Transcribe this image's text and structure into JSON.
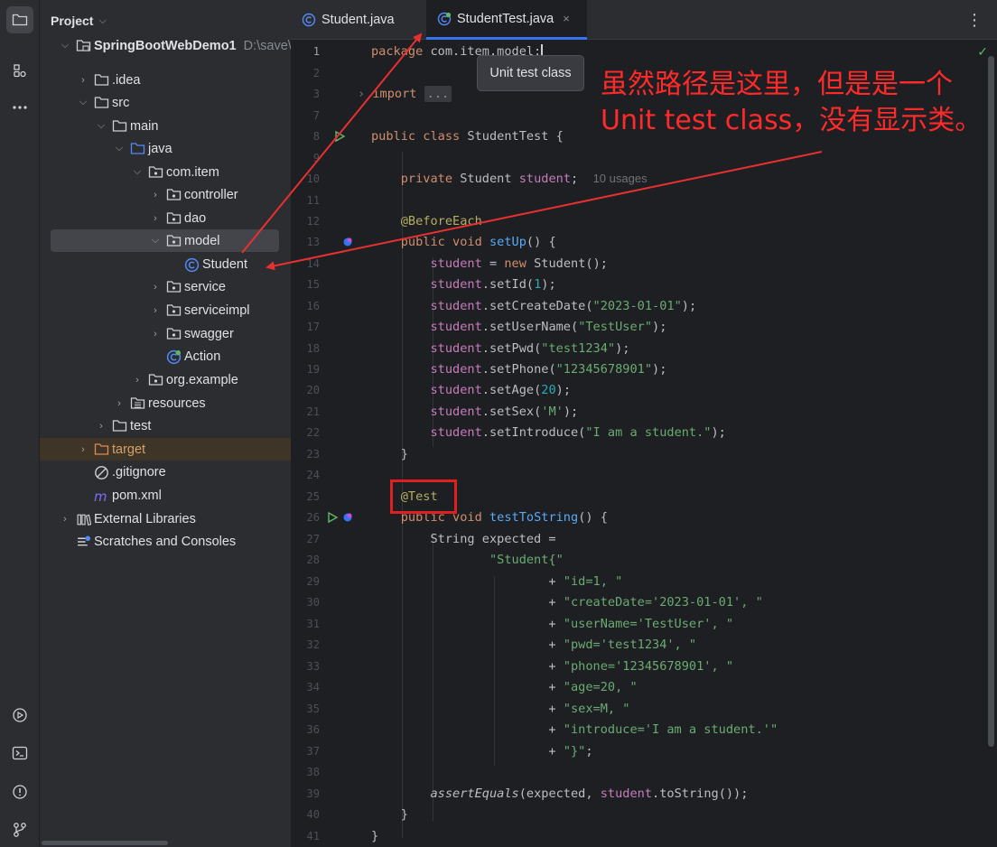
{
  "activity_bar": {
    "icons": [
      "folder-icon",
      "structure-icon",
      "more-icon",
      "services-icon",
      "terminal-icon",
      "problems-icon",
      "git-icon"
    ]
  },
  "project_panel": {
    "title": "Project",
    "tree": [
      {
        "label": "SpringBootWebDemo1",
        "path": "D:\\save\\",
        "icon": "module-folder",
        "expanded": true,
        "bold": true
      },
      {
        "label": ".idea",
        "icon": "folder",
        "expanded": false
      },
      {
        "label": "src",
        "icon": "folder",
        "expanded": true
      },
      {
        "label": "main",
        "icon": "folder",
        "expanded": true
      },
      {
        "label": "java",
        "icon": "source-folder",
        "expanded": true
      },
      {
        "label": "com.item",
        "icon": "package",
        "expanded": true
      },
      {
        "label": "controller",
        "icon": "package",
        "expanded": false
      },
      {
        "label": "dao",
        "icon": "package",
        "expanded": false
      },
      {
        "label": "model",
        "icon": "package",
        "expanded": true,
        "selected": true
      },
      {
        "label": "Student",
        "icon": "class"
      },
      {
        "label": "service",
        "icon": "package",
        "expanded": false
      },
      {
        "label": "serviceimpl",
        "icon": "package",
        "expanded": false
      },
      {
        "label": "swagger",
        "icon": "package",
        "expanded": false
      },
      {
        "label": "Action",
        "icon": "test-class"
      },
      {
        "label": "org.example",
        "icon": "package",
        "expanded": false
      },
      {
        "label": "resources",
        "icon": "resources-folder",
        "expanded": false
      },
      {
        "label": "test",
        "icon": "folder",
        "expanded": false
      },
      {
        "label": "target",
        "icon": "excluded-folder",
        "expanded": false
      },
      {
        "label": ".gitignore",
        "icon": "ignore-file"
      },
      {
        "label": "pom.xml",
        "icon": "maven-file"
      },
      {
        "label": "External Libraries",
        "icon": "library",
        "expanded": false
      },
      {
        "label": "Scratches and Consoles",
        "icon": "scratch"
      }
    ]
  },
  "tabs": [
    {
      "label": "Student.java",
      "active": false
    },
    {
      "label": "StudentTest.java",
      "active": true,
      "close": "×"
    }
  ],
  "tooltip": "Unit test class",
  "annotation": "虽然路径是这里，但是是一个Unit test class，没有显示类。",
  "editor": {
    "line_numbers": [
      "1",
      "2",
      "3",
      "7",
      "8",
      "9",
      "10",
      "11",
      "12",
      "13",
      "14",
      "15",
      "16",
      "17",
      "18",
      "19",
      "20",
      "21",
      "22",
      "23",
      "24",
      "25",
      "26",
      "27",
      "28",
      "29",
      "30",
      "31",
      "32",
      "33",
      "34",
      "35",
      "36",
      "37",
      "38",
      "39",
      "40",
      "41"
    ],
    "current_line": "1",
    "inlay_usages": "10 usages",
    "fold_placeholder": "..."
  }
}
